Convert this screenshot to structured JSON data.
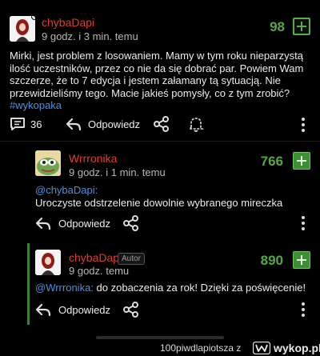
{
  "post": {
    "author": "chybaDapi",
    "time": "9 godz. i 3 min. temu",
    "votes": "98",
    "body": "Mirki, jest problem z losowaniem. Mamy w tym roku nieparzystą ilość uczestników, przez co nie da się dobrać par. Powiem Wam szczerze, że to 7 edycja i jestem załamany tą sytuacją. Nie przewidzieliśmy tego. Macie jakieś pomysły, co z tym zrobić?",
    "tag": "#wykopaka",
    "comments_count": "36",
    "reply_label": "Odpowiedz"
  },
  "comments": [
    {
      "author": "Wrrronika",
      "time": "9 godz. i 1 min. temu",
      "votes": "766",
      "mention": "@chybaDapi:",
      "body": "Uroczyste odstrzelenie dowolnie wybranego mireczka",
      "reply_label": "Odpowiedz"
    },
    {
      "author": "chybaDapi",
      "badge": "Autor",
      "time": "9 godz. temu",
      "votes": "890",
      "mention": "@Wrrronika:",
      "body": " do zobaczenia za rok! Dzięki za poświęcenie!",
      "reply_label": "Odpowiedz"
    }
  ],
  "footer": {
    "source": "100piwdlapiotsza",
    "letter": "z",
    "site": "wykop.pl"
  },
  "colors": {
    "username": "#e23d2a",
    "votes": "#57a845",
    "link": "#4b8fe0",
    "background": "#000000"
  }
}
